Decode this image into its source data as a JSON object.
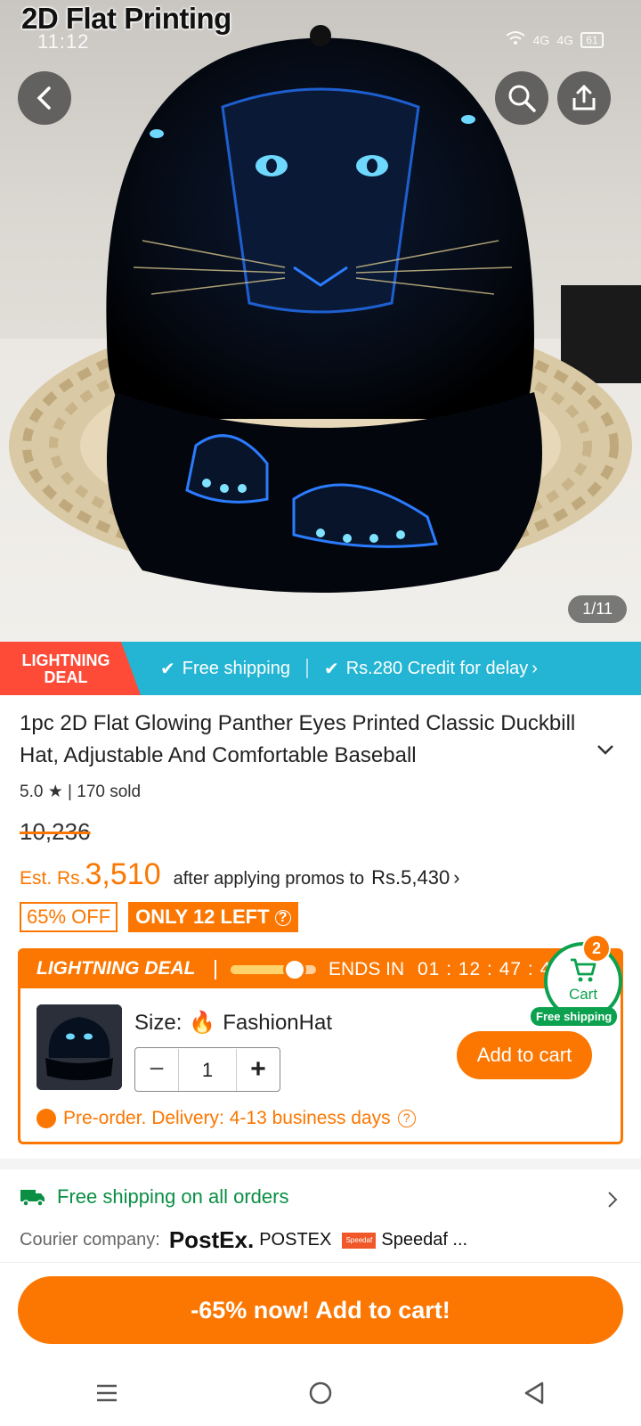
{
  "hero": {
    "overlay_title": "2D Flat Printing",
    "image_counter": "1/11"
  },
  "status": {
    "time": "11:12",
    "network1": "4G",
    "network2": "4G",
    "battery": "61"
  },
  "strip": {
    "deal_label": "LIGHTNING DEAL",
    "free_shipping": "Free shipping",
    "credit": "Rs.280 Credit for delay"
  },
  "product": {
    "title": "1pc 2D Flat Glowing Panther Eyes Printed Classic Duckbill Hat, Adjustable And Comfortable Baseball",
    "rating": "5.0",
    "sold": "170 sold",
    "old_price": "10,236",
    "est_label": "Est. Rs.",
    "est_price": "3,510",
    "after_text": "after applying promos to",
    "promo_price": "Rs.5,430",
    "off_badge": "65% OFF",
    "left_badge": "ONLY 12 LEFT"
  },
  "deal": {
    "title": "LIGHTNING DEAL",
    "progress": 0.75,
    "ends_label": "ENDS IN",
    "timer": "01 : 12 : 47 : 43",
    "size_label": "Size:",
    "size_value": "FashionHat",
    "quantity": "1",
    "add_to_cart": "Add to cart",
    "preorder": "Pre-order. Delivery: 4-13 business days"
  },
  "cart_float": {
    "label": "Cart",
    "count": "2",
    "shipping": "Free shipping"
  },
  "shipping": {
    "headline": "Free shipping on all orders",
    "courier_label": "Courier company:",
    "courier1_logo": "PostEx.",
    "courier1": "POSTEX",
    "courier2_logo": "Speedaf",
    "courier2": "Speedaf ..."
  },
  "cta": {
    "label": "-65% now! Add to cart!"
  },
  "colors": {
    "accent": "#fb7701",
    "strip": "#23b5d3",
    "green": "#0ca14f"
  }
}
